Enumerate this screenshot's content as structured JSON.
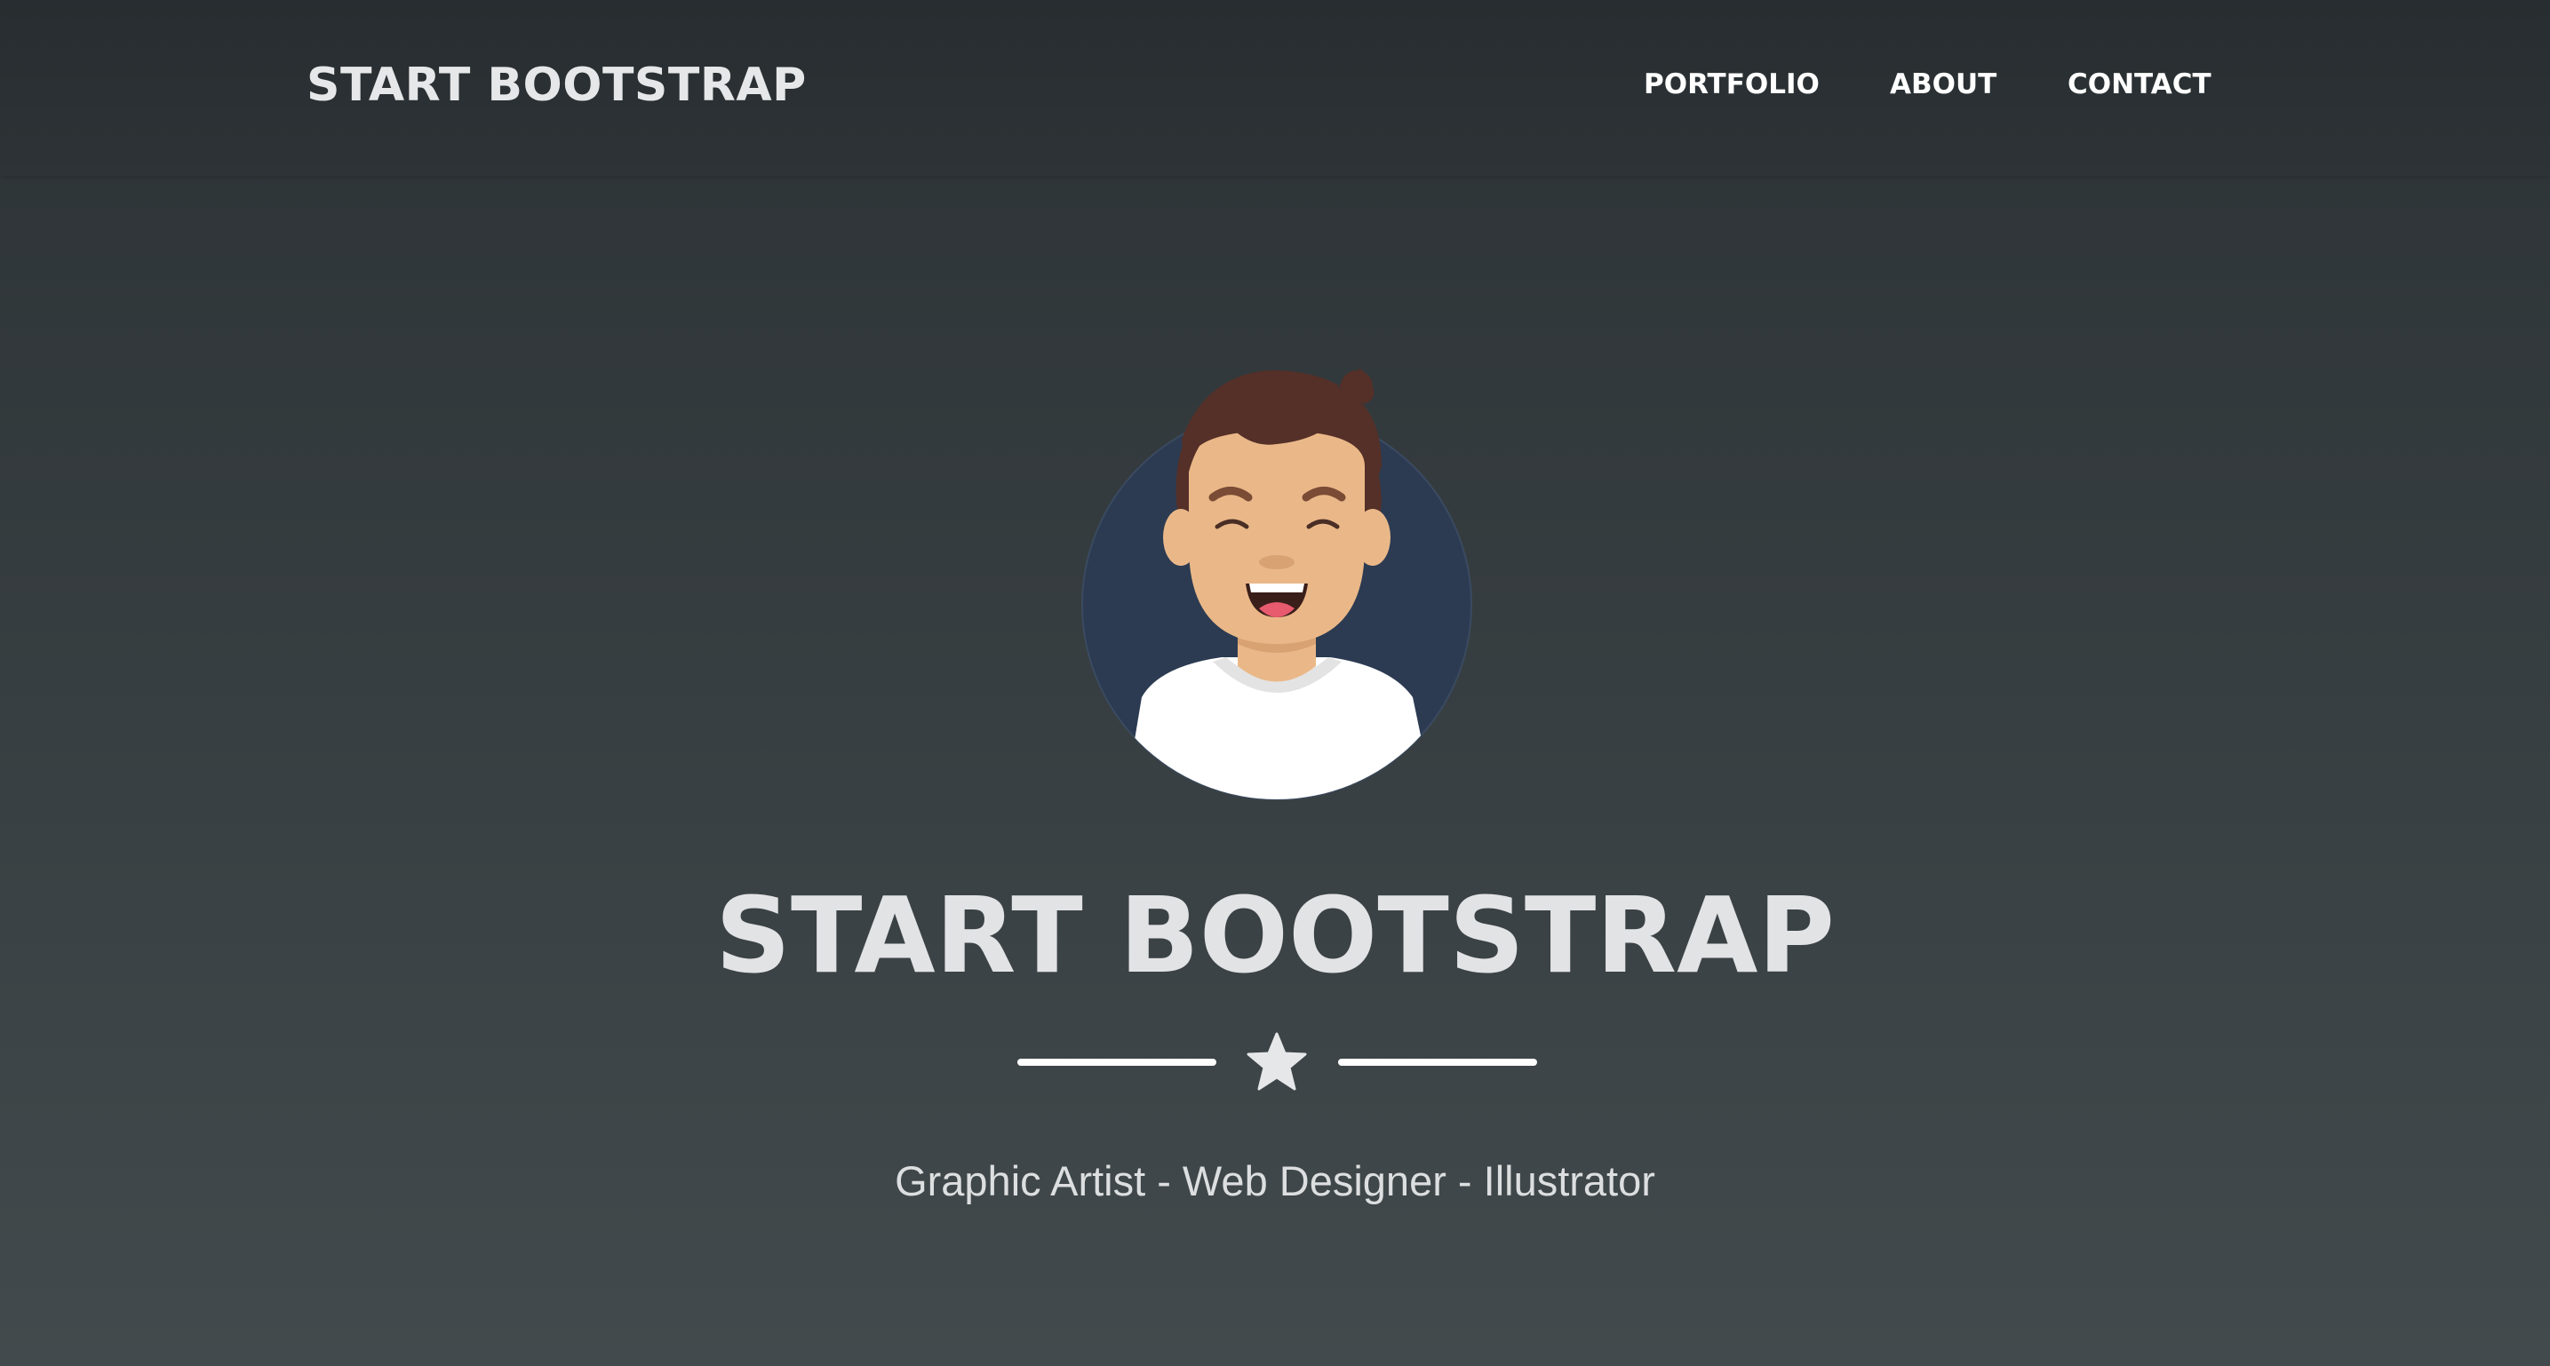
{
  "navbar": {
    "brand": "START BOOTSTRAP",
    "items": [
      {
        "label": "PORTFOLIO"
      },
      {
        "label": "ABOUT"
      },
      {
        "label": "CONTACT"
      }
    ]
  },
  "masthead": {
    "avatar_icon": "avatar-illustration",
    "title": "START BOOTSTRAP",
    "divider_icon": "star-icon",
    "subtitle": "Graphic Artist - Web Designer - Illustrator"
  },
  "colors": {
    "background_top": "#2c3235",
    "background_bottom": "#424a4d",
    "navbar": "#272d30",
    "text_light": "#e2e3e4",
    "avatar_circle": "#2c3b52",
    "skin": "#eab888",
    "hair": "#543028"
  }
}
